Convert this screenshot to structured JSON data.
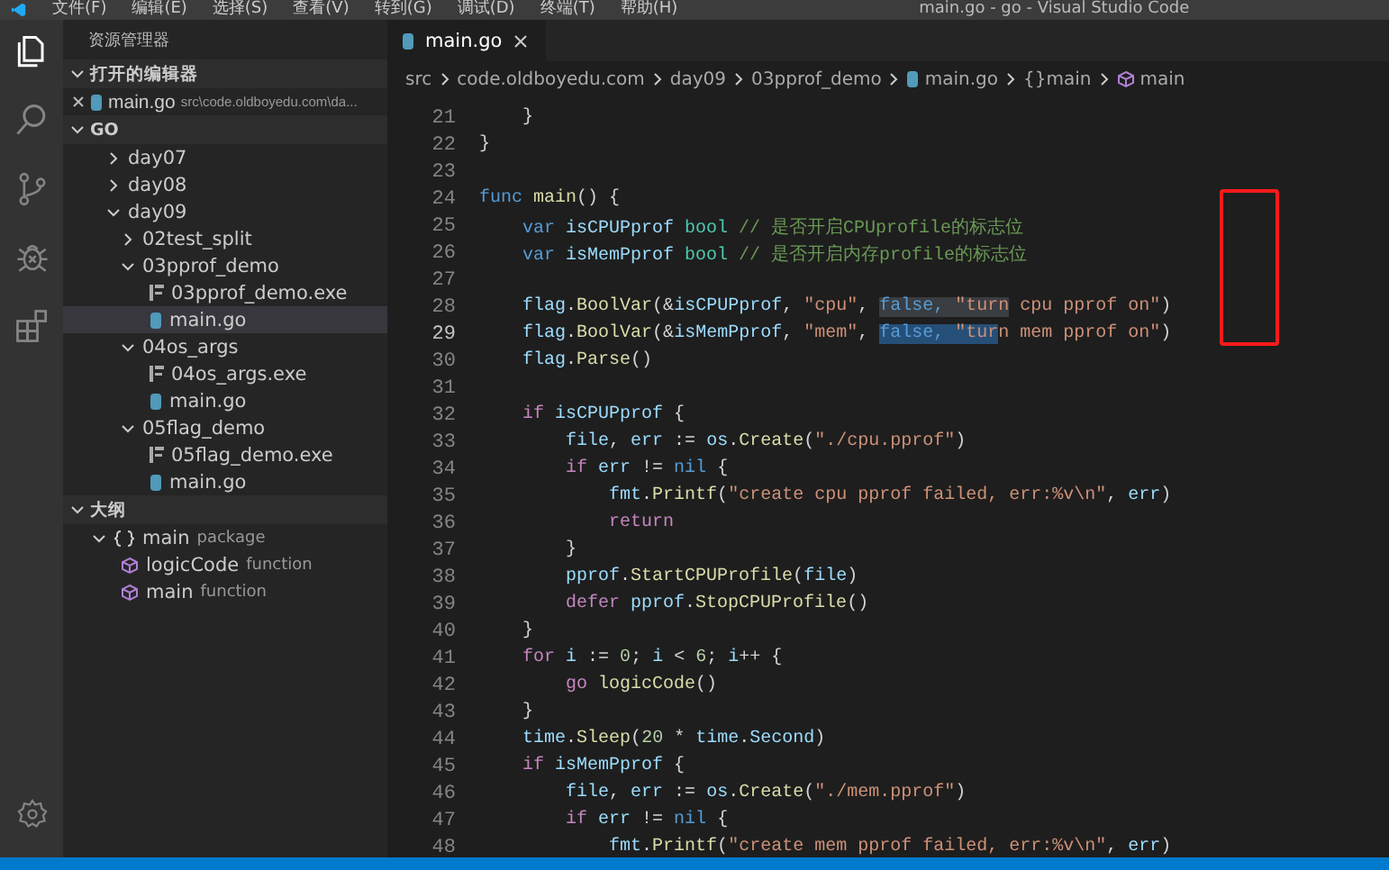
{
  "menu_bar": {
    "items": [
      "文件(F)",
      "编辑(E)",
      "选择(S)",
      "查看(V)",
      "转到(G)",
      "调试(D)",
      "终端(T)",
      "帮助(H)"
    ],
    "title": "main.go - go - Visual Studio Code"
  },
  "activity_bar": [
    {
      "kind": "files",
      "selected": true
    },
    {
      "kind": "search",
      "selected": false
    },
    {
      "kind": "scm",
      "selected": false
    },
    {
      "kind": "debug",
      "selected": false
    },
    {
      "kind": "extensions",
      "selected": false
    }
  ],
  "sidebar": {
    "title": "资源管理器",
    "open_editors": {
      "label": "打开的编辑器",
      "expanded": true,
      "items": [
        {
          "name": "main.go",
          "path": "src\\code.oldboyedu.com\\da..."
        }
      ]
    },
    "folder": {
      "label": "GO",
      "expanded": true,
      "items": [
        {
          "label": "day07",
          "kind": "folder",
          "expanded": false,
          "selected": false
        },
        {
          "label": "day08",
          "kind": "folder",
          "expanded": false,
          "selected": false
        },
        {
          "label": "day09",
          "kind": "folder",
          "expanded": true,
          "selected": false,
          "children": [
            {
              "label": "02test_split",
              "kind": "folder",
              "expanded": false,
              "selected": false
            },
            {
              "label": "03pprof_demo",
              "kind": "folder",
              "expanded": true,
              "selected": false,
              "children": [
                {
                  "label": "03pprof_demo.exe",
                  "kind": "exe",
                  "selected": false
                },
                {
                  "label": "main.go",
                  "kind": "go",
                  "selected": true
                }
              ]
            },
            {
              "label": "04os_args",
              "kind": "folder",
              "expanded": true,
              "selected": false,
              "children": [
                {
                  "label": "04os_args.exe",
                  "kind": "exe",
                  "selected": false
                },
                {
                  "label": "main.go",
                  "kind": "go",
                  "selected": false
                }
              ]
            },
            {
              "label": "05flag_demo",
              "kind": "folder",
              "expanded": true,
              "selected": false,
              "children": [
                {
                  "label": "05flag_demo.exe",
                  "kind": "exe",
                  "selected": false
                },
                {
                  "label": "main.go",
                  "kind": "go",
                  "selected": false
                }
              ]
            }
          ]
        }
      ]
    },
    "outline": {
      "label": "大纲",
      "expanded": true,
      "items": [
        {
          "label": "main",
          "detail": "package",
          "kind": "package",
          "expanded": true,
          "children": [
            {
              "label": "logicCode",
              "detail": "function",
              "kind": "function"
            },
            {
              "label": "main",
              "detail": "function",
              "kind": "function"
            }
          ]
        }
      ]
    }
  },
  "editor": {
    "tabs": [
      {
        "label": "main.go",
        "selected": true
      }
    ],
    "breadcrumb": [
      {
        "label": "src",
        "kind": "text"
      },
      {
        "label": "code.oldboyedu.com",
        "kind": "text"
      },
      {
        "label": "day09",
        "kind": "text"
      },
      {
        "label": "03pprof_demo",
        "kind": "text"
      },
      {
        "label": "main.go",
        "kind": "go"
      },
      {
        "label": "{}main",
        "kind": "text"
      },
      {
        "label": "main",
        "kind": "function"
      }
    ],
    "lines": [
      {
        "n": "21",
        "current": false,
        "tokens": [
          {
            "text": "    }",
            "kind": "plain"
          }
        ]
      },
      {
        "n": "22",
        "current": false,
        "tokens": [
          {
            "text": "}",
            "kind": "plain"
          }
        ]
      },
      {
        "n": "23",
        "current": false
      },
      {
        "n": "24",
        "current": false,
        "tokens": [
          {
            "text": "func",
            "kind": "keyword"
          },
          {
            "text": " main",
            "kind": "function"
          },
          {
            "text": "() {",
            "kind": "plain"
          }
        ]
      },
      {
        "n": "25",
        "current": false,
        "tokens": [
          {
            "text": "    var",
            "kind": "keyword"
          },
          {
            "text": " isCPUPprof",
            "kind": "variable"
          },
          {
            "text": " bool",
            "kind": "type"
          },
          {
            "text": " // 是否开启CPUprofile的标志位",
            "kind": "comment"
          }
        ]
      },
      {
        "n": "26",
        "current": false,
        "tokens": [
          {
            "text": "    var",
            "kind": "keyword"
          },
          {
            "text": " isMemPprof",
            "kind": "variable"
          },
          {
            "text": " bool",
            "kind": "type"
          },
          {
            "text": " // 是否开启内存profile的标志位",
            "kind": "comment"
          }
        ]
      },
      {
        "n": "27",
        "current": false
      },
      {
        "n": "28",
        "current": false,
        "tokens": [
          {
            "text": "    flag",
            "kind": "variable"
          },
          {
            "text": ".",
            "kind": "plain"
          },
          {
            "text": "BoolVar",
            "kind": "function"
          },
          {
            "text": "(&",
            "kind": "plain"
          },
          {
            "text": "isCPUPprof",
            "kind": "variable"
          },
          {
            "text": ", ",
            "kind": "plain"
          },
          {
            "text": "\"cpu\"",
            "kind": "string"
          },
          {
            "text": ", ",
            "kind": "plain"
          },
          {
            "text": "false, ",
            "kind": "keyword",
            "matched": true
          },
          {
            "text": "\"turn",
            "kind": "string",
            "matched": true
          },
          {
            "text": " cpu pprof on\"",
            "kind": "string"
          },
          {
            "text": ")",
            "kind": "plain"
          }
        ]
      },
      {
        "n": "29",
        "current": true,
        "tokens": [
          {
            "text": "    flag",
            "kind": "variable"
          },
          {
            "text": ".",
            "kind": "plain"
          },
          {
            "text": "BoolVar",
            "kind": "function"
          },
          {
            "text": "(&",
            "kind": "plain"
          },
          {
            "text": "isMemPprof",
            "kind": "variable"
          },
          {
            "text": ", ",
            "kind": "plain"
          },
          {
            "text": "\"mem\"",
            "kind": "string"
          },
          {
            "text": ", ",
            "kind": "plain"
          },
          {
            "text": "false, ",
            "kind": "keyword",
            "selected": true
          },
          {
            "text": "\"tur",
            "kind": "string",
            "selected": true
          },
          {
            "text": "n mem pprof on\"",
            "kind": "string"
          },
          {
            "text": ")",
            "kind": "plain"
          }
        ]
      },
      {
        "n": "30",
        "current": false,
        "tokens": [
          {
            "text": "    flag",
            "kind": "variable"
          },
          {
            "text": ".",
            "kind": "plain"
          },
          {
            "text": "Parse",
            "kind": "function"
          },
          {
            "text": "()",
            "kind": "plain"
          }
        ]
      },
      {
        "n": "31",
        "current": false
      },
      {
        "n": "32",
        "current": false,
        "tokens": [
          {
            "text": "    if",
            "kind": "control"
          },
          {
            "text": " isCPUPprof",
            "kind": "variable"
          },
          {
            "text": " {",
            "kind": "plain"
          }
        ]
      },
      {
        "n": "33",
        "current": false,
        "tokens": [
          {
            "text": "        file",
            "kind": "variable"
          },
          {
            "text": ", ",
            "kind": "plain"
          },
          {
            "text": "err",
            "kind": "variable"
          },
          {
            "text": " := ",
            "kind": "plain"
          },
          {
            "text": "os",
            "kind": "variable"
          },
          {
            "text": ".",
            "kind": "plain"
          },
          {
            "text": "Create",
            "kind": "function"
          },
          {
            "text": "(",
            "kind": "plain"
          },
          {
            "text": "\"./cpu.pprof\"",
            "kind": "string"
          },
          {
            "text": ")",
            "kind": "plain"
          }
        ]
      },
      {
        "n": "34",
        "current": false,
        "tokens": [
          {
            "text": "        if",
            "kind": "control"
          },
          {
            "text": " err",
            "kind": "variable"
          },
          {
            "text": " != ",
            "kind": "plain"
          },
          {
            "text": "nil",
            "kind": "keyword"
          },
          {
            "text": " {",
            "kind": "plain"
          }
        ]
      },
      {
        "n": "35",
        "current": false,
        "tokens": [
          {
            "text": "            fmt",
            "kind": "variable"
          },
          {
            "text": ".",
            "kind": "plain"
          },
          {
            "text": "Printf",
            "kind": "function"
          },
          {
            "text": "(",
            "kind": "plain"
          },
          {
            "text": "\"create cpu pprof failed, err:%v\\n\"",
            "kind": "string"
          },
          {
            "text": ", ",
            "kind": "plain"
          },
          {
            "text": "err",
            "kind": "variable"
          },
          {
            "text": ")",
            "kind": "plain"
          }
        ]
      },
      {
        "n": "36",
        "current": false,
        "tokens": [
          {
            "text": "            return",
            "kind": "control"
          }
        ]
      },
      {
        "n": "37",
        "current": false,
        "tokens": [
          {
            "text": "        }",
            "kind": "plain"
          }
        ]
      },
      {
        "n": "38",
        "current": false,
        "tokens": [
          {
            "text": "        pprof",
            "kind": "variable"
          },
          {
            "text": ".",
            "kind": "plain"
          },
          {
            "text": "StartCPUProfile",
            "kind": "function"
          },
          {
            "text": "(",
            "kind": "plain"
          },
          {
            "text": "file",
            "kind": "variable"
          },
          {
            "text": ")",
            "kind": "plain"
          }
        ]
      },
      {
        "n": "39",
        "current": false,
        "tokens": [
          {
            "text": "        defer",
            "kind": "control"
          },
          {
            "text": " pprof",
            "kind": "variable"
          },
          {
            "text": ".",
            "kind": "plain"
          },
          {
            "text": "StopCPUProfile",
            "kind": "function"
          },
          {
            "text": "()",
            "kind": "plain"
          }
        ]
      },
      {
        "n": "40",
        "current": false,
        "tokens": [
          {
            "text": "    }",
            "kind": "plain"
          }
        ]
      },
      {
        "n": "41",
        "current": false,
        "tokens": [
          {
            "text": "    for",
            "kind": "control"
          },
          {
            "text": " i",
            "kind": "variable"
          },
          {
            "text": " := ",
            "kind": "plain"
          },
          {
            "text": "0",
            "kind": "number"
          },
          {
            "text": "; ",
            "kind": "plain"
          },
          {
            "text": "i",
            "kind": "variable"
          },
          {
            "text": " < ",
            "kind": "plain"
          },
          {
            "text": "6",
            "kind": "number"
          },
          {
            "text": "; ",
            "kind": "plain"
          },
          {
            "text": "i",
            "kind": "variable"
          },
          {
            "text": "++ {",
            "kind": "plain"
          }
        ]
      },
      {
        "n": "42",
        "current": false,
        "tokens": [
          {
            "text": "        go",
            "kind": "control"
          },
          {
            "text": " logicCode",
            "kind": "function"
          },
          {
            "text": "()",
            "kind": "plain"
          }
        ]
      },
      {
        "n": "43",
        "current": false,
        "tokens": [
          {
            "text": "    }",
            "kind": "plain"
          }
        ]
      },
      {
        "n": "44",
        "current": false,
        "tokens": [
          {
            "text": "    time",
            "kind": "variable"
          },
          {
            "text": ".",
            "kind": "plain"
          },
          {
            "text": "Sleep",
            "kind": "function"
          },
          {
            "text": "(",
            "kind": "plain"
          },
          {
            "text": "20",
            "kind": "number"
          },
          {
            "text": " * ",
            "kind": "plain"
          },
          {
            "text": "time",
            "kind": "variable"
          },
          {
            "text": ".",
            "kind": "plain"
          },
          {
            "text": "Second",
            "kind": "variable"
          },
          {
            "text": ")",
            "kind": "plain"
          }
        ]
      },
      {
        "n": "45",
        "current": false,
        "tokens": [
          {
            "text": "    if",
            "kind": "control"
          },
          {
            "text": " isMemPprof",
            "kind": "variable"
          },
          {
            "text": " {",
            "kind": "plain"
          }
        ]
      },
      {
        "n": "46",
        "current": false,
        "tokens": [
          {
            "text": "        file",
            "kind": "variable"
          },
          {
            "text": ", ",
            "kind": "plain"
          },
          {
            "text": "err",
            "kind": "variable"
          },
          {
            "text": " := ",
            "kind": "plain"
          },
          {
            "text": "os",
            "kind": "variable"
          },
          {
            "text": ".",
            "kind": "plain"
          },
          {
            "text": "Create",
            "kind": "function"
          },
          {
            "text": "(",
            "kind": "plain"
          },
          {
            "text": "\"./mem.pprof\"",
            "kind": "string"
          },
          {
            "text": ")",
            "kind": "plain"
          }
        ]
      },
      {
        "n": "47",
        "current": false,
        "tokens": [
          {
            "text": "        if",
            "kind": "control"
          },
          {
            "text": " err",
            "kind": "variable"
          },
          {
            "text": " != ",
            "kind": "plain"
          },
          {
            "text": "nil",
            "kind": "keyword"
          },
          {
            "text": " {",
            "kind": "plain"
          }
        ]
      },
      {
        "n": "48",
        "current": false,
        "tokens": [
          {
            "text": "            fmt",
            "kind": "variable"
          },
          {
            "text": ".",
            "kind": "plain"
          },
          {
            "text": "Printf",
            "kind": "function"
          },
          {
            "text": "(",
            "kind": "plain"
          },
          {
            "text": "\"create mem pprof failed, err:%v\\n\"",
            "kind": "string"
          },
          {
            "text": ", ",
            "kind": "plain"
          },
          {
            "text": "err",
            "kind": "variable"
          },
          {
            "text": ")",
            "kind": "plain"
          }
        ]
      }
    ]
  }
}
